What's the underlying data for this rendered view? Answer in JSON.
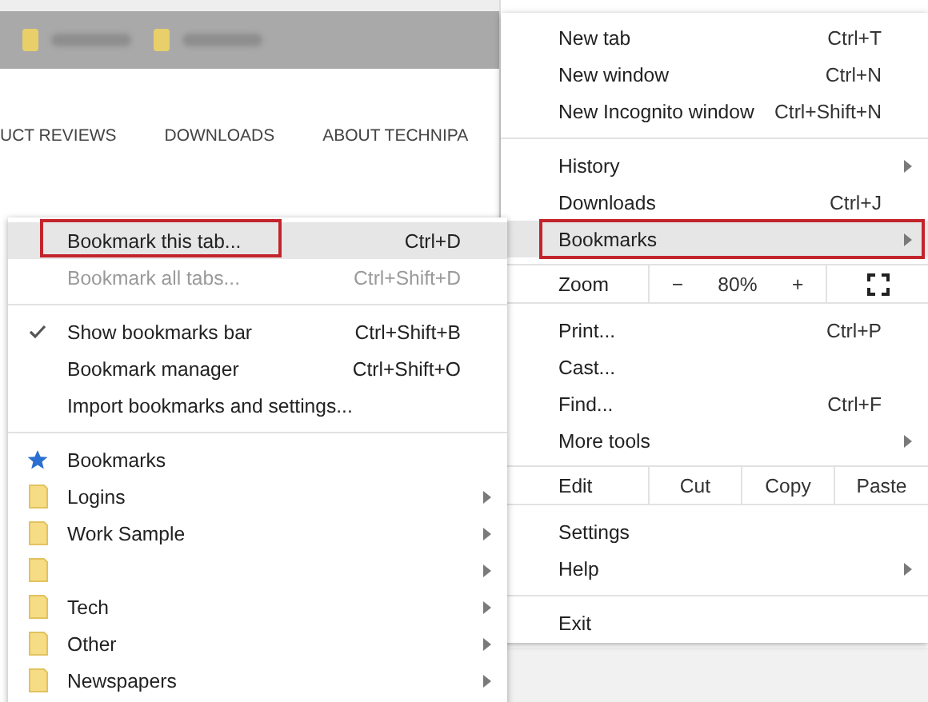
{
  "page": {
    "bookmarks_bar": {
      "items": [
        {
          "kind": "folder"
        },
        {
          "kind": "folder"
        }
      ]
    },
    "nav": [
      "UCT REVIEWS",
      "DOWNLOADS",
      "ABOUT TECHNIPA"
    ]
  },
  "bookmarks_menu": {
    "items": [
      {
        "kind": "item",
        "label": "Bookmark this tab...",
        "shortcut": "Ctrl+D",
        "selected": true,
        "outlined": true,
        "disabled": false,
        "checked": false
      },
      {
        "kind": "item",
        "label": "Bookmark all tabs...",
        "shortcut": "Ctrl+Shift+D",
        "selected": false,
        "outlined": false,
        "disabled": true,
        "checked": false
      },
      {
        "kind": "separator"
      },
      {
        "kind": "item",
        "label": "Show bookmarks bar",
        "shortcut": "Ctrl+Shift+B",
        "selected": false,
        "outlined": false,
        "disabled": false,
        "checked": true
      },
      {
        "kind": "item",
        "label": "Bookmark manager",
        "shortcut": "Ctrl+Shift+O",
        "selected": false,
        "outlined": false,
        "disabled": false,
        "checked": false
      },
      {
        "kind": "item",
        "label": "Import bookmarks and settings...",
        "selected": false,
        "outlined": false,
        "disabled": false,
        "checked": false
      },
      {
        "kind": "separator"
      },
      {
        "kind": "bookmark",
        "label": "Bookmarks",
        "submenu": false
      },
      {
        "kind": "folder",
        "label": "Logins",
        "submenu": true
      },
      {
        "kind": "folder",
        "label": "Work Sample",
        "submenu": true
      },
      {
        "kind": "folder",
        "submenu": true
      },
      {
        "kind": "folder",
        "label": "Tech",
        "submenu": true
      },
      {
        "kind": "folder",
        "label": "Other",
        "submenu": true
      },
      {
        "kind": "folder",
        "label": "Newspapers",
        "submenu": true
      }
    ]
  },
  "main_menu": {
    "items": [
      {
        "kind": "item",
        "label": "New tab",
        "shortcut": "Ctrl+T",
        "submenu": false,
        "selected": false,
        "outlined": false
      },
      {
        "kind": "item",
        "label": "New window",
        "shortcut": "Ctrl+N",
        "submenu": false,
        "selected": false,
        "outlined": false
      },
      {
        "kind": "item",
        "label": "New Incognito window",
        "shortcut": "Ctrl+Shift+N",
        "submenu": false,
        "selected": false,
        "outlined": false
      },
      {
        "kind": "separator"
      },
      {
        "kind": "item",
        "label": "History",
        "submenu": true,
        "selected": false,
        "outlined": false
      },
      {
        "kind": "item",
        "label": "Downloads",
        "shortcut": "Ctrl+J",
        "submenu": false,
        "selected": false,
        "outlined": false
      },
      {
        "kind": "item",
        "label": "Bookmarks",
        "submenu": true,
        "selected": true,
        "outlined": true
      },
      {
        "kind": "zoom",
        "label": "Zoom",
        "minus": "−",
        "value": "80%",
        "plus": "+"
      },
      {
        "kind": "item",
        "label": "Print...",
        "shortcut": "Ctrl+P",
        "submenu": false,
        "selected": false,
        "outlined": false
      },
      {
        "kind": "item",
        "label": "Cast...",
        "submenu": false,
        "selected": false,
        "outlined": false
      },
      {
        "kind": "item",
        "label": "Find...",
        "shortcut": "Ctrl+F",
        "submenu": false,
        "selected": false,
        "outlined": false
      },
      {
        "kind": "item",
        "label": "More tools",
        "submenu": true,
        "selected": false,
        "outlined": false
      },
      {
        "kind": "edit",
        "label": "Edit",
        "actions": [
          "Cut",
          "Copy",
          "Paste"
        ]
      },
      {
        "kind": "item",
        "label": "Settings",
        "submenu": false,
        "selected": false,
        "outlined": false
      },
      {
        "kind": "item",
        "label": "Help",
        "submenu": true,
        "selected": false,
        "outlined": false
      },
      {
        "kind": "separator"
      },
      {
        "kind": "item",
        "label": "Exit",
        "submenu": false,
        "selected": false,
        "outlined": false
      }
    ]
  }
}
